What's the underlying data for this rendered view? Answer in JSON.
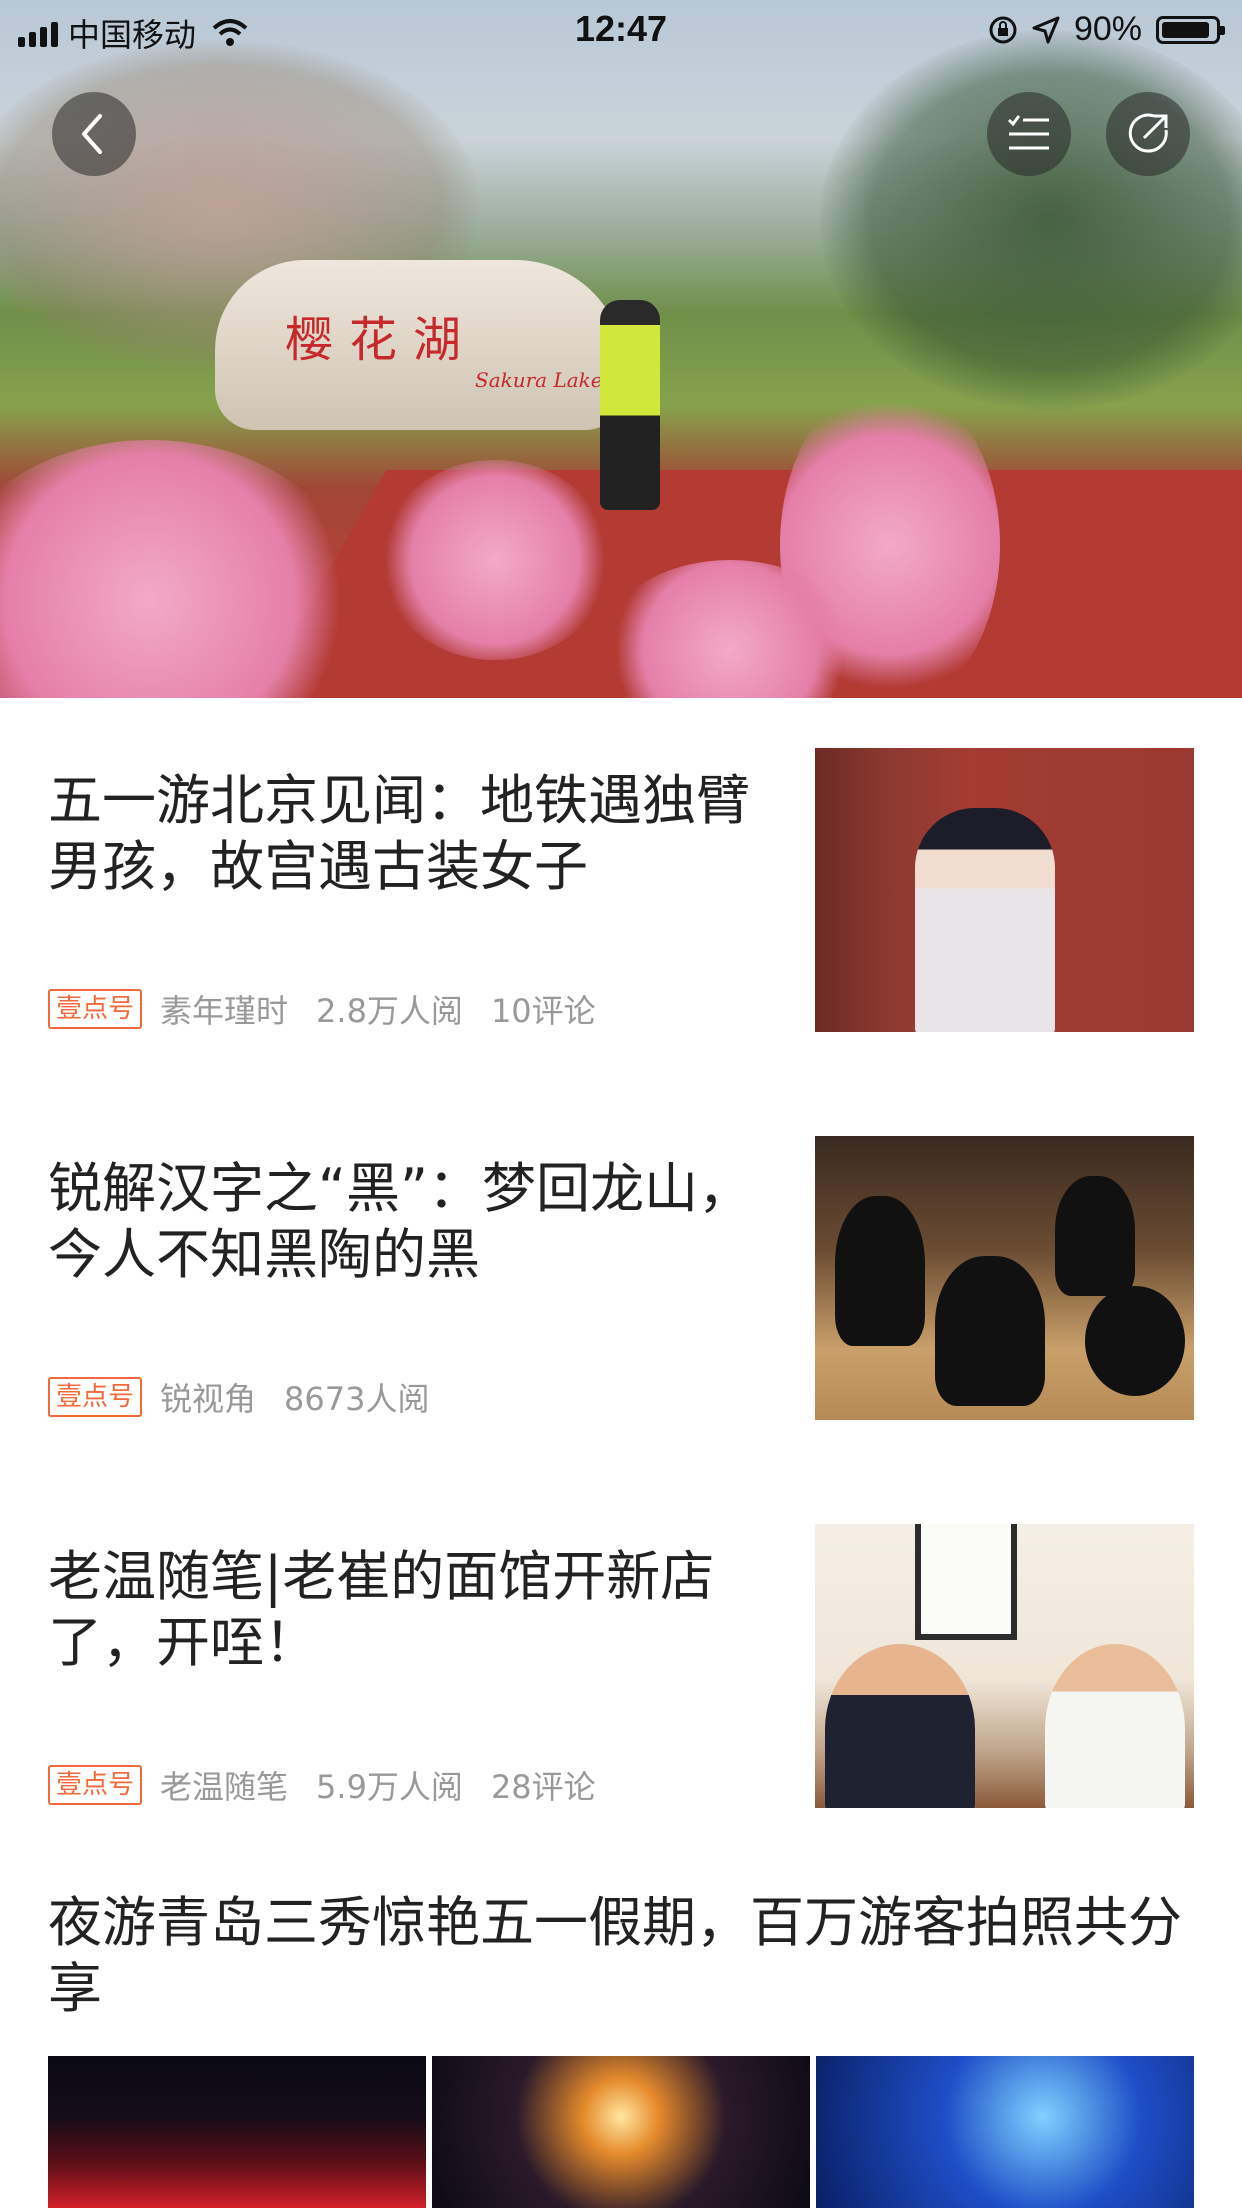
{
  "status_bar": {
    "carrier": "中国移动",
    "time": "12:47",
    "battery": "90%",
    "battery_level": 0.9
  },
  "hero": {
    "stone_text": "樱花湖",
    "stone_subtext": "Sakura Lake",
    "back_icon": "chevron-left-icon",
    "font_icon": "text-settings-icon",
    "share_icon": "share-icon"
  },
  "articles": [
    {
      "title": "五一游北京见闻：地铁遇独臂男孩，故宫遇古装女子",
      "tag": "壹点号",
      "source": "素年瑾时",
      "reads": "2.8万人阅",
      "comments": "10评论"
    },
    {
      "title": "锐解汉字之“黑”：梦回龙山，今人不知黑陶的黑",
      "tag": "壹点号",
      "source": "锐视角",
      "reads": "8673人阅",
      "comments": ""
    },
    {
      "title": "老温随笔|老崔的面馆开新店了，开咥！",
      "tag": "壹点号",
      "source": "老温随笔",
      "reads": "5.9万人阅",
      "comments": "28评论"
    }
  ],
  "gallery_article": {
    "title": " 夜游青岛三秀惊艳五一假期，百万游客拍照共分享"
  },
  "colors": {
    "tag_orange": "#f26a3a",
    "meta_gray": "#999999",
    "title_text": "#222222"
  }
}
